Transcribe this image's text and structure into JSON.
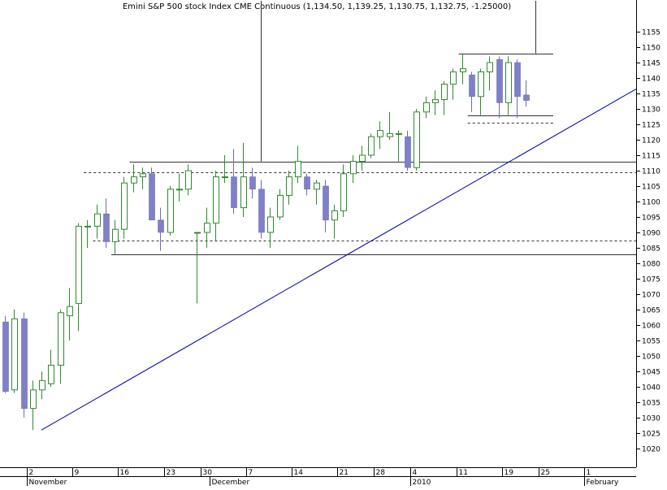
{
  "chart_data": {
    "type": "candlestick",
    "title": "Emini S&P 500 stock Index CME Continuous (1,134.50, 1,139.25, 1,130.75, 1,132.75, -1.25000)",
    "ylim": [
      1014,
      1160
    ],
    "y_ticks": [
      1020,
      1025,
      1030,
      1035,
      1040,
      1045,
      1050,
      1055,
      1060,
      1065,
      1070,
      1075,
      1080,
      1085,
      1090,
      1095,
      1100,
      1105,
      1110,
      1115,
      1120,
      1125,
      1130,
      1135,
      1140,
      1145,
      1150,
      1155
    ],
    "y_tick_labels": [
      "1020",
      "1025",
      "1030",
      "1035",
      "1040",
      "1045",
      "1050",
      "1055",
      "1060",
      "1065",
      "1070",
      "1075",
      "1080",
      "1085",
      "1090",
      "1095",
      "1100",
      "1105",
      "1110",
      "1115",
      "1120",
      "1125",
      "1130",
      "1135",
      "1140",
      "1145",
      "1150",
      "1155"
    ],
    "x_ticks": [
      {
        "index": 3,
        "label": "2"
      },
      {
        "index": 8,
        "label": "9"
      },
      {
        "index": 13,
        "label": "16"
      },
      {
        "index": 18,
        "label": "23"
      },
      {
        "index": 22,
        "label": "30"
      },
      {
        "index": 27,
        "label": "7"
      },
      {
        "index": 32,
        "label": "14"
      },
      {
        "index": 37,
        "label": "21"
      },
      {
        "index": 41,
        "label": "28"
      },
      {
        "index": 45,
        "label": "4"
      },
      {
        "index": 50,
        "label": "11"
      },
      {
        "index": 55,
        "label": "19"
      },
      {
        "index": 59,
        "label": "25"
      },
      {
        "index": 64,
        "label": "1"
      }
    ],
    "month_labels": [
      {
        "index": 3,
        "label": "November"
      },
      {
        "index": 23,
        "label": "December"
      },
      {
        "index": 45,
        "label": "2010"
      },
      {
        "index": 64,
        "label": "February"
      }
    ],
    "colors": {
      "up": "#2e8b2e",
      "down_fill": "#8080c8",
      "down_border": "#6c6cb8",
      "trend": "#0000b0",
      "level": "#333333",
      "axis": "#000000",
      "background": "#ffffff"
    },
    "candles": [
      {
        "o": 1061.0,
        "h": 1063.0,
        "l": 1038.0,
        "c": 1038.5
      },
      {
        "o": 1039.0,
        "h": 1065.0,
        "l": 1038.0,
        "c": 1062.0
      },
      {
        "o": 1062.0,
        "h": 1064.0,
        "l": 1030.0,
        "c": 1033.0
      },
      {
        "o": 1033.0,
        "h": 1042.0,
        "l": 1026.0,
        "c": 1039.0
      },
      {
        "o": 1039.0,
        "h": 1045.0,
        "l": 1036.0,
        "c": 1042.0
      },
      {
        "o": 1041.0,
        "h": 1052.0,
        "l": 1040.0,
        "c": 1047.0
      },
      {
        "o": 1047.0,
        "h": 1065.0,
        "l": 1041.0,
        "c": 1064.0
      },
      {
        "o": 1063.0,
        "h": 1072.0,
        "l": 1055.0,
        "c": 1066.0
      },
      {
        "o": 1067.0,
        "h": 1093.0,
        "l": 1058.0,
        "c": 1092.0
      },
      {
        "o": 1092.0,
        "h": 1094.0,
        "l": 1085.0,
        "c": 1092.0
      },
      {
        "o": 1092.0,
        "h": 1099.0,
        "l": 1088.0,
        "c": 1096.0
      },
      {
        "o": 1096.0,
        "h": 1101.0,
        "l": 1085.0,
        "c": 1087.0
      },
      {
        "o": 1087.0,
        "h": 1094.0,
        "l": 1083.0,
        "c": 1091.0
      },
      {
        "o": 1091.0,
        "h": 1108.0,
        "l": 1088.0,
        "c": 1106.0
      },
      {
        "o": 1106.0,
        "h": 1112.0,
        "l": 1103.0,
        "c": 1108.0
      },
      {
        "o": 1108.0,
        "h": 1111.0,
        "l": 1104.0,
        "c": 1109.0
      },
      {
        "o": 1109.0,
        "h": 1111.0,
        "l": 1095.0,
        "c": 1094.0
      },
      {
        "o": 1094.0,
        "h": 1098.0,
        "l": 1084.0,
        "c": 1090.0
      },
      {
        "o": 1090.0,
        "h": 1105.0,
        "l": 1089.0,
        "c": 1104.0
      },
      {
        "o": 1104.0,
        "h": 1109.0,
        "l": 1100.0,
        "c": 1104.0
      },
      {
        "o": 1104.0,
        "h": 1112.0,
        "l": 1102.0,
        "c": 1110.0
      },
      {
        "o": 1090.0,
        "h": 1090.0,
        "l": 1067.0,
        "c": 1090.0
      },
      {
        "o": 1090.0,
        "h": 1098.0,
        "l": 1085.0,
        "c": 1093.0
      },
      {
        "o": 1093.0,
        "h": 1110.0,
        "l": 1087.0,
        "c": 1108.0
      },
      {
        "o": 1108.0,
        "h": 1115.0,
        "l": 1106.0,
        "c": 1108.0
      },
      {
        "o": 1108.0,
        "h": 1117.0,
        "l": 1096.0,
        "c": 1098.0
      },
      {
        "o": 1098.0,
        "h": 1119.0,
        "l": 1095.0,
        "c": 1108.0
      },
      {
        "o": 1108.0,
        "h": 1111.0,
        "l": 1101.0,
        "c": 1104.0
      },
      {
        "o": 1104.0,
        "h": 1107.0,
        "l": 1088.0,
        "c": 1090.0
      },
      {
        "o": 1090.0,
        "h": 1098.0,
        "l": 1085.0,
        "c": 1095.0
      },
      {
        "o": 1095.0,
        "h": 1104.0,
        "l": 1094.0,
        "c": 1102.0
      },
      {
        "o": 1102.0,
        "h": 1110.0,
        "l": 1099.0,
        "c": 1108.0
      },
      {
        "o": 1108.0,
        "h": 1118.0,
        "l": 1106.0,
        "c": 1113.0
      },
      {
        "o": 1108.0,
        "h": 1109.0,
        "l": 1102.0,
        "c": 1104.0
      },
      {
        "o": 1104.0,
        "h": 1107.0,
        "l": 1099.0,
        "c": 1106.0
      },
      {
        "o": 1105.0,
        "h": 1107.0,
        "l": 1090.0,
        "c": 1094.0
      },
      {
        "o": 1094.0,
        "h": 1099.0,
        "l": 1088.0,
        "c": 1097.0
      },
      {
        "o": 1097.0,
        "h": 1112.0,
        "l": 1095.0,
        "c": 1109.0
      },
      {
        "o": 1109.0,
        "h": 1115.0,
        "l": 1106.0,
        "c": 1113.0
      },
      {
        "o": 1113.0,
        "h": 1118.0,
        "l": 1110.0,
        "c": 1115.0
      },
      {
        "o": 1115.0,
        "h": 1122.0,
        "l": 1114.0,
        "c": 1121.0
      },
      {
        "o": 1121.0,
        "h": 1126.0,
        "l": 1117.0,
        "c": 1123.0
      },
      {
        "o": 1121.0,
        "h": 1129.0,
        "l": 1120.0,
        "c": 1122.0
      },
      {
        "o": 1122.0,
        "h": 1123.0,
        "l": 1113.0,
        "c": 1122.0
      },
      {
        "o": 1121.0,
        "h": 1123.0,
        "l": 1110.0,
        "c": 1111.0
      },
      {
        "o": 1111.0,
        "h": 1130.0,
        "l": 1110.0,
        "c": 1129.0
      },
      {
        "o": 1129.0,
        "h": 1134.0,
        "l": 1127.0,
        "c": 1132.0
      },
      {
        "o": 1132.0,
        "h": 1136.0,
        "l": 1128.0,
        "c": 1133.0
      },
      {
        "o": 1133.0,
        "h": 1139.0,
        "l": 1128.0,
        "c": 1138.0
      },
      {
        "o": 1138.0,
        "h": 1143.0,
        "l": 1133.0,
        "c": 1142.0
      },
      {
        "o": 1142.0,
        "h": 1148.0,
        "l": 1138.0,
        "c": 1143.0
      },
      {
        "o": 1141.0,
        "h": 1142.0,
        "l": 1129.0,
        "c": 1134.0
      },
      {
        "o": 1134.0,
        "h": 1143.0,
        "l": 1128.0,
        "c": 1142.0
      },
      {
        "o": 1142.0,
        "h": 1147.0,
        "l": 1136.0,
        "c": 1145.0
      },
      {
        "o": 1146.0,
        "h": 1147.0,
        "l": 1127.0,
        "c": 1132.0
      },
      {
        "o": 1132.0,
        "h": 1147.0,
        "l": 1128.0,
        "c": 1145.0
      },
      {
        "o": 1145.0,
        "h": 1146.0,
        "l": 1127.0,
        "c": 1134.0
      },
      {
        "o": 1134.5,
        "h": 1139.25,
        "l": 1130.75,
        "c": 1132.75
      }
    ],
    "trendline": {
      "from": {
        "index": 4,
        "price": 1026.0
      },
      "to": {
        "index": 80,
        "price": 1155.0
      }
    },
    "level_lines": [
      {
        "price": 1113.0,
        "style": "solid",
        "from_index": 14,
        "to_index": 80
      },
      {
        "price": 1109.5,
        "style": "dashed",
        "from_index": 9,
        "to_index": 80
      },
      {
        "price": 1087.5,
        "style": "dashed",
        "from_index": 10,
        "to_index": 80
      },
      {
        "price": 1083.0,
        "style": "solid",
        "from_index": 12,
        "to_index": 80
      },
      {
        "price": 1148.0,
        "style": "solid",
        "from_index": 50,
        "to_index": 60
      },
      {
        "price": 1128.0,
        "style": "solid",
        "from_index": 51,
        "to_index": 60
      },
      {
        "price": 1125.5,
        "style": "dashed",
        "from_index": 51,
        "to_index": 60
      }
    ],
    "marker_lines": [
      {
        "index": 28,
        "from_price": 1113.0,
        "to_price": 1165.0
      },
      {
        "index": 58,
        "from_price": 1148.0,
        "to_price": 1165.0
      }
    ]
  }
}
